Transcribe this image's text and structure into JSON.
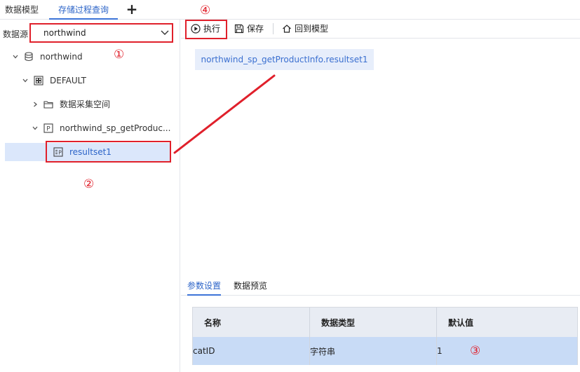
{
  "tabs": {
    "model": "数据模型",
    "sp_query": "存储过程查询",
    "add": "+"
  },
  "datasource": {
    "label": "数据源",
    "selected": "northwind"
  },
  "tree": {
    "db": "northwind",
    "schema": "DEFAULT",
    "folder": "数据采集空间",
    "procedure": "northwind_sp_getProduc...",
    "resultset": "resultset1"
  },
  "toolbar": {
    "execute": "执行",
    "save": "保存",
    "back": "回到模型"
  },
  "result_chip": "northwind_sp_getProductInfo.resultset1",
  "bottom_tabs": {
    "params": "参数设置",
    "preview": "数据预览"
  },
  "params_table": {
    "headers": [
      "名称",
      "数据类型",
      "默认值"
    ],
    "rows": [
      [
        "catID",
        "字符串",
        "1"
      ]
    ]
  },
  "callouts": [
    "①",
    "②",
    "③",
    "④"
  ],
  "colors": {
    "accent": "#3c74d8",
    "annotation": "#e0202b",
    "selection": "#dbe7fb",
    "row_selected": "#c8dbf6"
  }
}
